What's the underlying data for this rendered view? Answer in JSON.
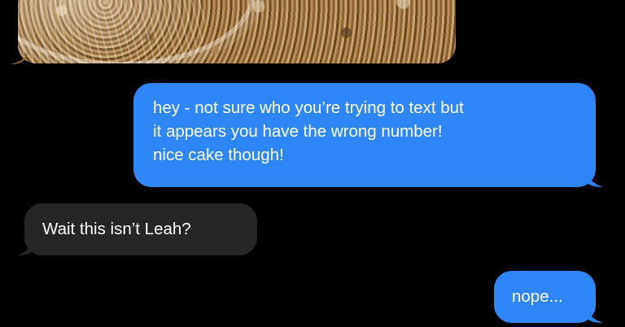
{
  "conversation": {
    "messages": [
      {
        "direction": "sent",
        "lines": [
          "hey - not sure who you’re trying to text but",
          "it appears you have the wrong number!",
          "nice cake though!"
        ]
      },
      {
        "direction": "received",
        "text": "Wait this isn’t Leah?"
      },
      {
        "direction": "sent",
        "text": "nope..."
      }
    ]
  },
  "colors": {
    "background": "#000000",
    "sent_bubble": "#2f86f6",
    "received_bubble": "#262628",
    "text": "#ffffff"
  }
}
